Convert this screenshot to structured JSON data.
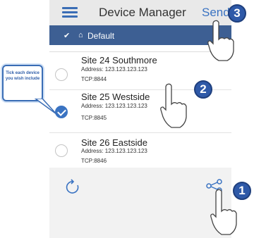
{
  "header": {
    "title": "Device Manager",
    "send_label": "Send"
  },
  "breadcrumb": {
    "label": "Default"
  },
  "devices": [
    {
      "name": "Site 24 Southmore",
      "address": "Address: 123.123.123.123",
      "tcp": "TCP:8844",
      "checked": false
    },
    {
      "name": "Site 25 Westside",
      "address": "Address: 123.123.123.123",
      "tcp": "TCP:8845",
      "checked": true
    },
    {
      "name": "Site 26 Eastside",
      "address": "Address: 123.123.123.123",
      "tcp": "TCP:8846",
      "checked": false
    }
  ],
  "callout": {
    "text": "Tick each device you wish include"
  },
  "steps": {
    "one": "1",
    "two": "2",
    "three": "3"
  },
  "icons": {
    "menu": "menu-icon",
    "home": "home-icon",
    "chevron": "chevron-down-icon",
    "refresh": "refresh-icon",
    "share": "share-icon",
    "hand": "pointing-hand-icon"
  },
  "colors": {
    "accent": "#3a73c2",
    "nav": "#3d5f93",
    "badge": "#2e59a8"
  }
}
